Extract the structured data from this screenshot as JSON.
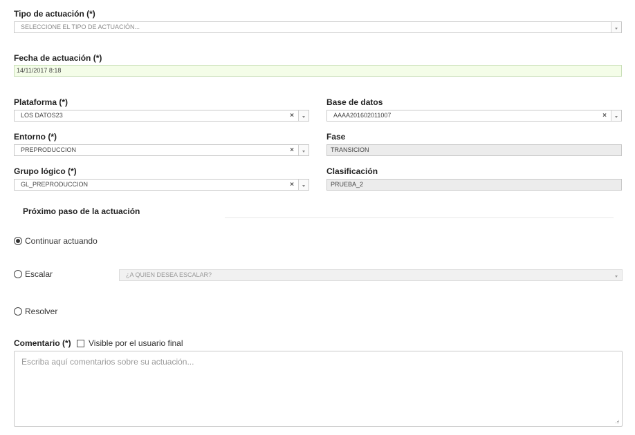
{
  "tipo": {
    "label": "Tipo de actuación (*)",
    "placeholder": "SELECCIONE EL TIPO DE ACTUACIÓN..."
  },
  "fecha": {
    "label": "Fecha de actuación (*)",
    "value": "14/11/2017 8:18"
  },
  "plataforma": {
    "label": "Plataforma (*)",
    "value": "LOS DATOS23",
    "clear": "×"
  },
  "base_datos": {
    "label": "Base de datos",
    "value": "AAAA201602011007",
    "clear": "×"
  },
  "entorno": {
    "label": "Entorno (*)",
    "value": "PREPRODUCCION",
    "clear": "×"
  },
  "fase": {
    "label": "Fase",
    "value": "TRANSICION"
  },
  "grupo": {
    "label": "Grupo lógico (*)",
    "value": "GL_PREPRODUCCION",
    "clear": "×"
  },
  "clasificacion": {
    "label": "Clasificación",
    "value": "PRUEBA_2"
  },
  "next_step": {
    "title": "Próximo paso de la actuación",
    "options": [
      {
        "label": "Continuar actuando",
        "checked": true
      },
      {
        "label": "Escalar",
        "checked": false
      },
      {
        "label": "Resolver",
        "checked": false
      }
    ],
    "escalar_placeholder": "¿A QUIEN DESEA ESCALAR?"
  },
  "comentario": {
    "label": "Comentario (*)",
    "visible_label": "Visible por el usuario final",
    "visible_checked": false,
    "placeholder": "Escriba aquí comentarios sobre su actuación..."
  },
  "icons": {
    "dropdown": "chevron-down-icon",
    "clear": "close-icon",
    "resize": "resize-grip-icon"
  },
  "colors": {
    "date_bg": "#f4fde8",
    "readonly_bg": "#ececec",
    "border": "#c8c8c8"
  }
}
